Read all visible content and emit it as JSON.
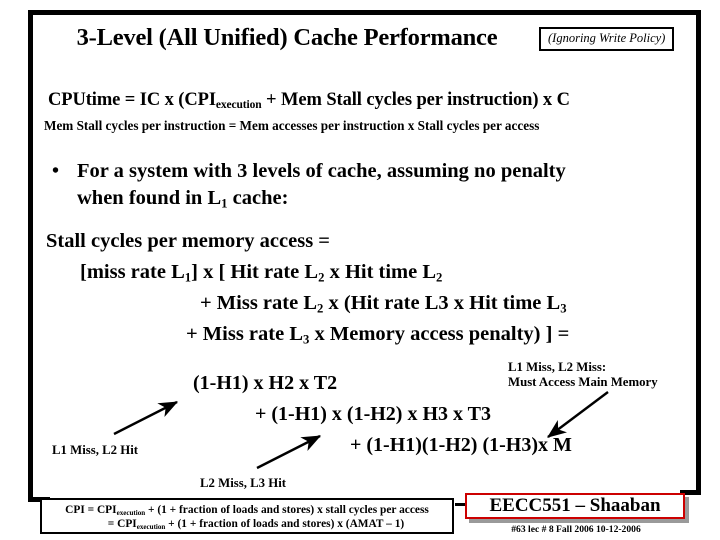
{
  "slide": {
    "title": "3-Level (All Unified) Cache Performance",
    "policy_note": "(Ignoring Write Policy)",
    "cputime_formula_prefix": "CPUtime  =  IC x  (CPI",
    "cputime_sub": "execution",
    "cputime_formula_suffix": " + Mem Stall  cycles per instruction)    x   C",
    "mem_stall_line": "Mem Stall cycles per instruction =  Mem accesses per instruction  x  Stall cycles per access",
    "bullet_marker": "•",
    "bullet_text_a": "For a system with 3 levels of cache, assuming no penalty",
    "bullet_text_b": "when found in L",
    "bullet_sub": "1",
    "bullet_text_c": " cache:",
    "stall_heading": "Stall cycles per memory access =",
    "eq_line1_a": "[miss rate L",
    "eq_line1_sub1": "1",
    "eq_line1_b": "] x  [ Hit rate L",
    "eq_line1_sub2": "2",
    "eq_line1_c": "  x Hit time L",
    "eq_line1_sub3": "2",
    "eq_line2_a": "+  Miss rate L",
    "eq_line2_sub1": "2",
    "eq_line2_b": " x  (Hit rate L3 x Hit time L",
    "eq_line2_sub2": "3",
    "eq_line3_a": "+  Miss rate L",
    "eq_line3_sub1": "3",
    "eq_line3_b": "  x  Memory access penalty) ]  =",
    "expanded_1": "(1-H1) x H2 x T2",
    "expanded_2": "+   (1-H1) x (1-H2) x H3 x T3",
    "expanded_3": "+      (1-H1)(1-H2) (1-H3)x M",
    "annotation_right_line1": "L1 Miss,  L2 Miss:",
    "annotation_right_line2": "Must Access Main Memory",
    "annotation_l1": "L1 Miss,  L2  Hit",
    "annotation_l2": "L2 Miss,  L3  Hit",
    "cpi_line1_a": "CPI = CPI",
    "cpi_line1_sub": "execution",
    "cpi_line1_b": "  +  (1 + fraction of loads and stores) x stall cycles per access",
    "cpi_line2_a": "= CPI",
    "cpi_line2_sub": "execution",
    "cpi_line2_b": "  +  (1 + fraction of loads and stores) x (AMAT – 1)",
    "footer_title": "EECC551 – Shaaban",
    "footer_sub": "#63   lec # 8   Fall 2006  10-12-2006",
    "colors": {
      "footer_border": "#cc0000",
      "frame": "#000000",
      "text": "#000000"
    }
  }
}
